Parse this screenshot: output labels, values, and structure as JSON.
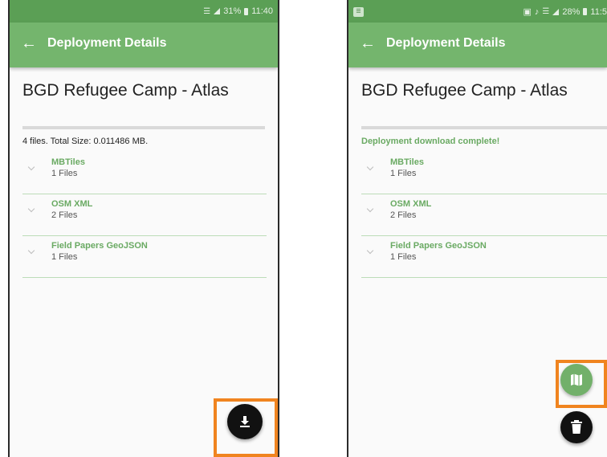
{
  "colors": {
    "status_bar": "#5b9f55",
    "app_bar": "#74b56d",
    "accent_green": "#6aaa63",
    "fab_dark": "#111111",
    "highlight_orange": "#f0841f"
  },
  "screens": [
    {
      "status_bar": {
        "icons": [
          "wifi-icon",
          "signal-icon",
          "battery-icon"
        ],
        "battery": "31%",
        "time": "11:40"
      },
      "app_bar": {
        "title": "Deployment Details",
        "back_icon": "back-arrow-icon"
      },
      "deployment_title": "BGD Refugee Camp - Atlas",
      "summary": "4 files. Total Size: 0.011486 MB.",
      "file_groups": [
        {
          "name": "MBTiles",
          "count": "1 Files"
        },
        {
          "name": "OSM XML",
          "count": "2 Files"
        },
        {
          "name": "Field Papers GeoJSON",
          "count": "1 Files"
        }
      ],
      "fabs": [
        {
          "icon": "download-icon",
          "highlighted": true
        }
      ]
    },
    {
      "status_bar": {
        "icons": [
          "app-notification-icon",
          "nfc-icon",
          "mute-icon",
          "wifi-icon",
          "signal-icon",
          "battery-icon"
        ],
        "battery": "28%",
        "time": "11:5"
      },
      "app_bar": {
        "title": "Deployment Details",
        "back_icon": "back-arrow-icon"
      },
      "deployment_title": "BGD Refugee Camp - Atlas",
      "summary": "Deployment download complete!",
      "file_groups": [
        {
          "name": "MBTiles",
          "count": "1 Files"
        },
        {
          "name": "OSM XML",
          "count": "2 Files"
        },
        {
          "name": "Field Papers GeoJSON",
          "count": "1 Files"
        }
      ],
      "fabs": [
        {
          "icon": "map-icon",
          "highlighted": true
        },
        {
          "icon": "trash-icon",
          "highlighted": false
        }
      ]
    }
  ]
}
